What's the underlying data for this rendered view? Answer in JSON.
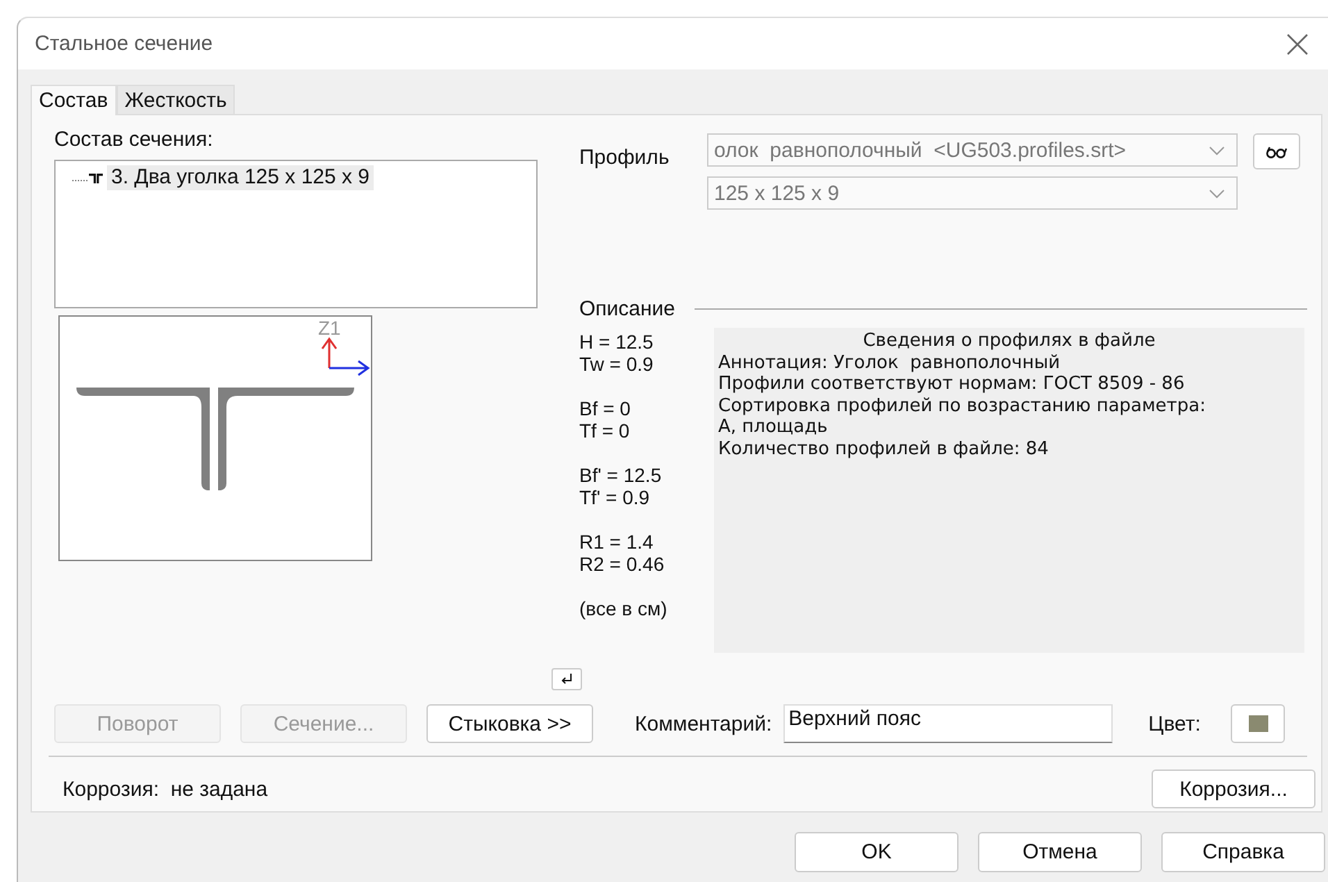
{
  "window": {
    "title": "Стальное сечение"
  },
  "tabs": [
    {
      "label": "Состав",
      "selected": true
    },
    {
      "label": "Жесткость",
      "selected": false
    }
  ],
  "composition": {
    "label": "Состав сечения:",
    "items": [
      {
        "text": "3. Два уголка 125 x 125 x 9",
        "selected": true
      }
    ]
  },
  "preview": {
    "axis_label": "Z1"
  },
  "profile": {
    "label": "Профиль",
    "combos": [
      {
        "value": "олок  равнополочный  <UG503.profiles.srt>",
        "disabled": true
      },
      {
        "value": "125 x 125 x 9",
        "disabled": true
      }
    ]
  },
  "description": {
    "label": "Описание",
    "param_groups": [
      [
        "H = 12.5",
        "Tw = 0.9"
      ],
      [
        "Bf = 0",
        "Tf = 0"
      ],
      [
        "Bf' = 12.5",
        "Tf' = 0.9"
      ],
      [
        "R1 = 1.4",
        "R2 = 0.46"
      ],
      [
        "(все в см)"
      ]
    ],
    "info": {
      "title": "Сведения о профилях в файле",
      "lines": [
        "Аннотация: Уголок  равнополочный",
        "Профили соответствуют нормам: ГОСТ 8509 - 86",
        "Сортировка профилей по возрастанию параметра:",
        "А, площадь",
        "Количество профилей в файле: 84"
      ]
    }
  },
  "actions": [
    {
      "label": "Поворот",
      "disabled": true
    },
    {
      "label": "Сечение...",
      "disabled": true
    },
    {
      "label": "Стыковка >>",
      "disabled": false
    }
  ],
  "comment": {
    "label": "Комментарий:",
    "value": "Верхний пояс"
  },
  "color": {
    "label": "Цвет:",
    "color": "#8a8a70"
  },
  "corrosion": {
    "text": "Коррозия:  не задана",
    "button": "Коррозия..."
  },
  "footer": [
    "OK",
    "Отмена",
    "Справка"
  ]
}
